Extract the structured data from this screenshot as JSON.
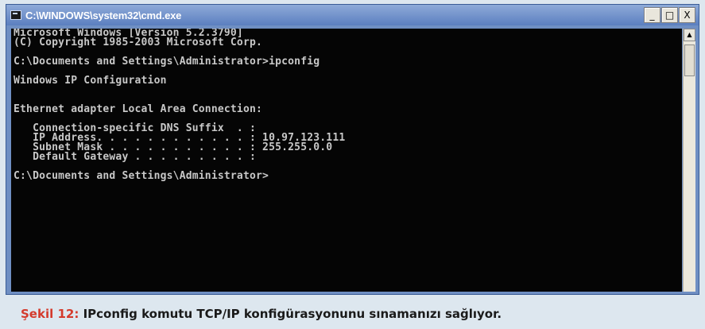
{
  "window": {
    "title": "C:\\WINDOWS\\system32\\cmd.exe",
    "controls": {
      "minimize": "_",
      "maximize": "□",
      "close": "X"
    }
  },
  "console": {
    "lines": [
      "Microsoft Windows [Version 5.2.3790]",
      "(C) Copyright 1985-2003 Microsoft Corp.",
      "",
      "C:\\Documents and Settings\\Administrator>ipconfig",
      "",
      "Windows IP Configuration",
      "",
      "",
      "Ethernet adapter Local Area Connection:",
      "",
      "   Connection-specific DNS Suffix  . :",
      "   IP Address. . . . . . . . . . . . : 10.97.123.111",
      "   Subnet Mask . . . . . . . . . . . : 255.255.0.0",
      "   Default Gateway . . . . . . . . . :",
      "",
      "C:\\Documents and Settings\\Administrator>"
    ]
  },
  "caption": {
    "label": "Şekil 12:",
    "text": " IPconfig komutu TCP/IP konfigürasyonunu sınamanızı sağlıyor."
  },
  "colors": {
    "caption_label": "#d43a2c",
    "console_bg": "#050505",
    "console_text": "#c8c8c8"
  }
}
